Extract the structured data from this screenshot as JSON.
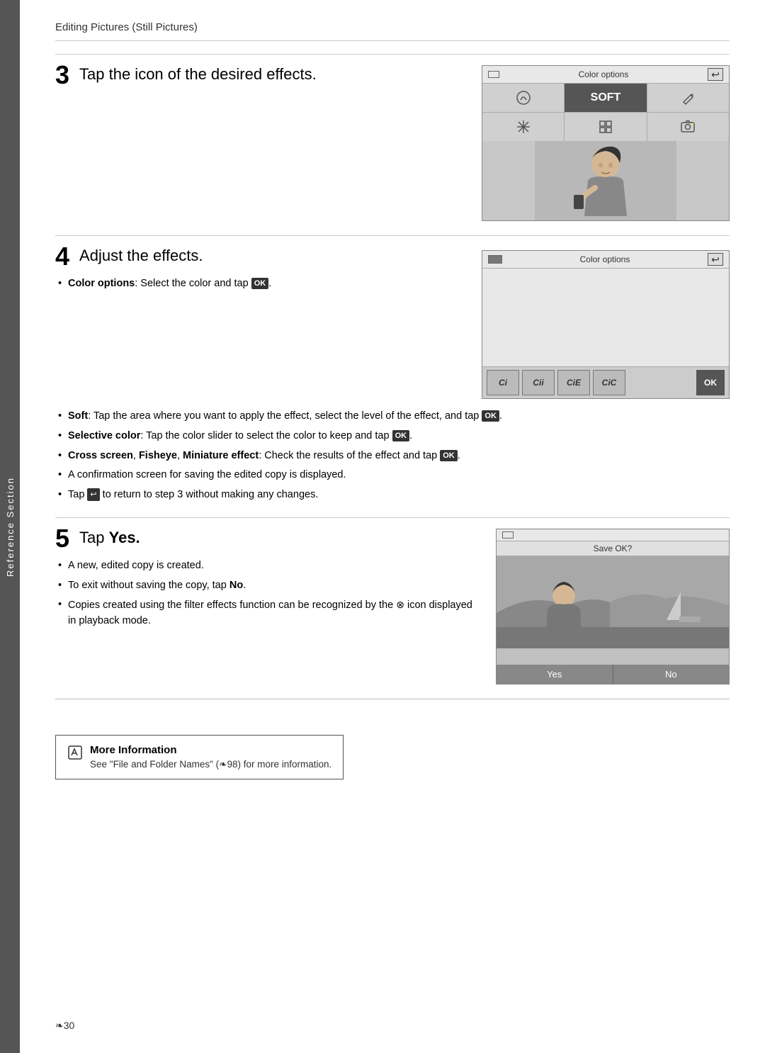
{
  "page": {
    "header": "Editing Pictures (Still Pictures)",
    "side_tab": "Reference Section",
    "footer": "❧30"
  },
  "step3": {
    "number": "3",
    "title": "Tap the icon of the desired effects.",
    "screen_title": "Color options",
    "screen_mode": "SOFT",
    "back_icon": "↩"
  },
  "step4": {
    "number": "4",
    "title": "Adjust the effects.",
    "screen_title": "Color options",
    "back_icon": "↩",
    "bullets": [
      {
        "label": "Color options",
        "text": ": Select the color and tap ",
        "badge": "OK"
      }
    ],
    "bullets_extra": [
      {
        "label": "Soft",
        "text": ": Tap the area where you want to apply the effect, select the level of the effect, and tap ",
        "badge": "OK"
      },
      {
        "label": "Selective color",
        "text": ": Tap the color slider to select the color to keep and tap ",
        "badge": "OK"
      },
      {
        "label": "Cross screen",
        "text": ", ",
        "label2": "Fisheye",
        "text2": ", ",
        "label3": "Miniature effect",
        "text3": ": Check the results of the effect and tap ",
        "badge": "OK"
      },
      {
        "text": "A confirmation screen for saving the edited copy is displayed."
      },
      {
        "text": "Tap  to return to step 3 without making any changes.",
        "has_return_icon": true
      }
    ],
    "color_btns": [
      "Ci",
      "CiI",
      "CiE",
      "CiC"
    ],
    "color_btn_ok": "OK"
  },
  "step5": {
    "number": "5",
    "title": "Tap ",
    "title_bold": "Yes.",
    "save_title": "Save OK?",
    "yes_label": "Yes",
    "no_label": "No",
    "bullets": [
      {
        "text": "A new, edited copy is created."
      },
      {
        "text": "To exit without saving the copy, tap ",
        "bold_word": "No",
        "text_after": "."
      },
      {
        "text": "Copies created using the filter effects function can be recognized by the  icon displayed in playback mode.",
        "has_filter_icon": true
      }
    ]
  },
  "more_info": {
    "title": "More Information",
    "text": "See \"File and Folder Names\" (❧98) for more information.",
    "icon": "✎"
  }
}
